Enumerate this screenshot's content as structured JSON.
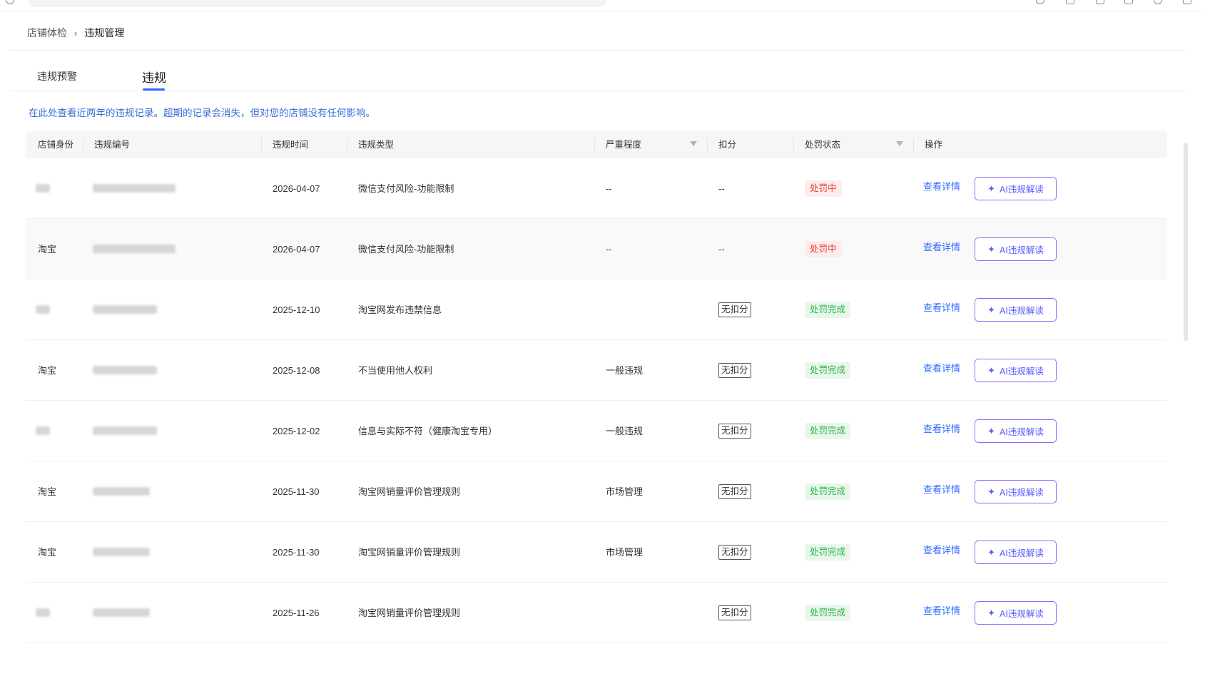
{
  "breadcrumb": {
    "parent": "店铺体检",
    "separator": "›",
    "current": "违规管理"
  },
  "tabs": [
    {
      "label": "违规预警",
      "active": false
    },
    {
      "label": "违规",
      "active": true
    }
  ],
  "notice": "在此处查看近两年的违规记录。超期的记录会消失，但对您的店铺没有任何影响。",
  "table": {
    "headers": {
      "shop_identity": "店铺身份",
      "violation_no": "违规编号",
      "violation_time": "违规时间",
      "violation_type": "违规类型",
      "severity": "严重程度",
      "deduction": "扣分",
      "penalty_status": "处罚状态",
      "action": "操作"
    },
    "rows": [
      {
        "shop": "",
        "time": "2026-04-07",
        "type": "微信支付风险-功能限制",
        "severity": "--",
        "deduction": "--",
        "status": "处罚中",
        "status_kind": "red"
      },
      {
        "shop": "淘宝",
        "time": "2026-04-07",
        "type": "微信支付风险-功能限制",
        "severity": "--",
        "deduction": "--",
        "status": "处罚中",
        "status_kind": "red"
      },
      {
        "shop": "",
        "time": "2025-12-10",
        "type": "淘宝网发布违禁信息",
        "severity": "",
        "deduction": "无扣分",
        "status": "处罚完成",
        "status_kind": "green"
      },
      {
        "shop": "淘宝",
        "time": "2025-12-08",
        "type": "不当使用他人权利",
        "severity": "一般违规",
        "deduction": "无扣分",
        "status": "处罚完成",
        "status_kind": "green"
      },
      {
        "shop": "",
        "time": "2025-12-02",
        "type": "信息与实际不符（健康淘宝专用）",
        "severity": "一般违规",
        "deduction": "无扣分",
        "status": "处罚完成",
        "status_kind": "green"
      },
      {
        "shop": "淘宝",
        "time": "2025-11-30",
        "type": "淘宝网销量评价管理规则",
        "severity": "市场管理",
        "deduction": "无扣分",
        "status": "处罚完成",
        "status_kind": "green"
      },
      {
        "shop": "淘宝",
        "time": "2025-11-30",
        "type": "淘宝网销量评价管理规则",
        "severity": "市场管理",
        "deduction": "无扣分",
        "status": "处罚完成",
        "status_kind": "green"
      },
      {
        "shop": "",
        "time": "2025-11-26",
        "type": "淘宝网销量评价管理规则",
        "severity": "",
        "deduction": "无扣分",
        "status": "处罚完成",
        "status_kind": "green"
      }
    ],
    "view_detail_label": "查看详情",
    "ai_button_label": "AI违规解读",
    "ai_icon": "sparkle-icon"
  },
  "colors": {
    "accent": "#2f6bff",
    "danger": "#e8403a",
    "success": "#28b34a",
    "ai": "#5a5fff"
  }
}
